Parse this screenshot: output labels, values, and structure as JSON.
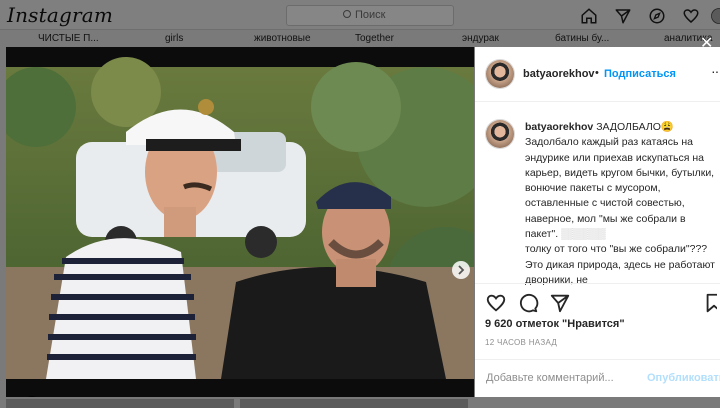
{
  "topbar": {
    "logo": "Instagram",
    "search_placeholder": "Поиск"
  },
  "stories": [
    "ЧИСТЫЕ П...",
    "girls",
    "животновые",
    "Together",
    "эндурак",
    "батины бу...",
    "аналитика"
  ],
  "post": {
    "username": "batyaorekhov",
    "follow_label": "Подписаться",
    "caption_title": "ЗАДОЛБАЛО😩",
    "caption_text": "Задолбало каждый раз катаясь на эндурике или приехав искупаться на карьер, видеть кругом бычки, бутылки, вонючие пакеты с мусором, оставленные с чистой совестью, наверное, мол \"мы же собрали в пакет\".",
    "caption_text_2": "толку от того что \"вы же собрали\"??? Это дикая природа, здесь не работают дворники, не",
    "likes": "9 620 отметок \"Нравится\"",
    "time_ago": "12 ЧАСОВ НАЗАД",
    "comment_placeholder": "Добавьте комментарий...",
    "publish_label": "Опубликовать",
    "carousel_count": 8,
    "carousel_active": 0
  },
  "colors": {
    "accent": "#0095f6",
    "text": "#262626",
    "muted": "#8e8e8e"
  }
}
